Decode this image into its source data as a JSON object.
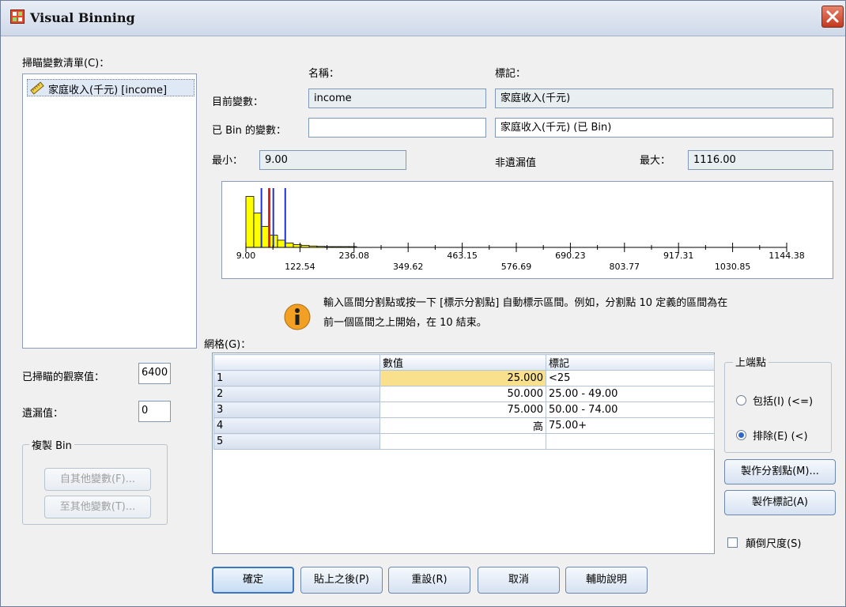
{
  "window": {
    "title": "Visual Binning"
  },
  "var_list": {
    "label": "掃瞄變數清單(C)：",
    "items": [
      {
        "label": "家庭收入(千元) [income]"
      }
    ]
  },
  "name_header": "名稱：",
  "label_header": "標記：",
  "current_var": {
    "label": "目前變數：",
    "name": "income",
    "var_label": "家庭收入(千元)"
  },
  "binned_var": {
    "label": "已 Bin 的變數：",
    "name": "",
    "var_label": "家庭收入(千元) (已 Bin)"
  },
  "min": {
    "label": "最小：",
    "value": "9.00"
  },
  "nonmissing_label": "非遺漏值",
  "max": {
    "label": "最大：",
    "value": "1116.00"
  },
  "histogram": {
    "tick_labels_row1": [
      "9.00",
      "236.08",
      "463.15",
      "690.23",
      "917.31",
      "1144.38"
    ],
    "tick_labels_row2": [
      "122.54",
      "349.62",
      "576.69",
      "803.77",
      "1030.85"
    ],
    "cutpoints": [
      25,
      50,
      75
    ],
    "bars": [
      0.92,
      0.62,
      0.38,
      0.22,
      0.13,
      0.08,
      0.05,
      0.035,
      0.025,
      0.018,
      0.012,
      0.008,
      0.006,
      0.004
    ],
    "colors": {
      "bar": "#ffff00",
      "red_line": "#e02020",
      "blue_line": "#1f2fd0"
    }
  },
  "info_text_line1": "輸入區間分割點或按一下 [標示分割點] 自動標示區間。例如，分割點 10 定義的區間為在",
  "info_text_line2": "前一個區間之上開始，在 10 結束。",
  "grid": {
    "label": "網格(G)：",
    "col_value": "數值",
    "col_label": "標記",
    "rows": [
      {
        "num": "1",
        "value": "25.000",
        "label": "<25"
      },
      {
        "num": "2",
        "value": "50.000",
        "label": "25.00 - 49.00"
      },
      {
        "num": "3",
        "value": "75.000",
        "label": "50.00 - 74.00"
      },
      {
        "num": "4",
        "value": "高",
        "label": "75.00+"
      },
      {
        "num": "5",
        "value": "",
        "label": ""
      }
    ]
  },
  "scanned_cases": {
    "label": "已掃瞄的觀察值：",
    "value": "6400"
  },
  "missing": {
    "label": "遺漏值：",
    "value": "0"
  },
  "copy_bins": {
    "title": "複製 Bin",
    "from_button": "自其他變數(F)...",
    "to_button": "至其他變數(T)..."
  },
  "upper_endpoint": {
    "title": "上端點",
    "included": "包括(I) (<=)",
    "excluded": "排除(E) (<)",
    "selected": "excluded"
  },
  "make_cutpoints_button": "製作分割點(M)...",
  "make_labels_button": "製作標記(A)",
  "reverse_scale": {
    "label": "顛倒尺度(S)",
    "checked": false
  },
  "footer": {
    "ok": "確定",
    "paste": "貼上之後(P)",
    "reset": "重設(R)",
    "cancel": "取消",
    "help": "輔助說明"
  }
}
